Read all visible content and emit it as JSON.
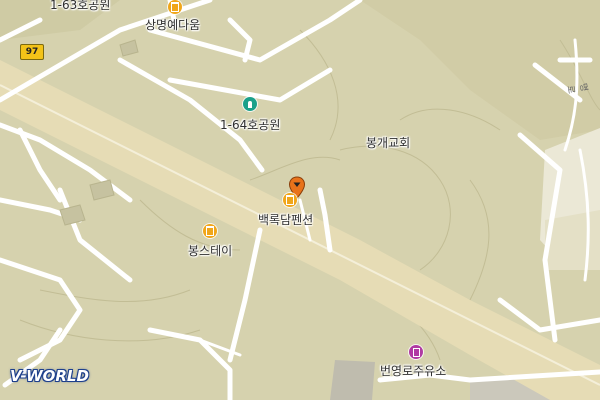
{
  "map": {
    "route_shield": "97",
    "labels": {
      "park_1_63": "1-63호공원",
      "sangmyeong": "상명예다움",
      "park_1_64": "1-64호공원",
      "bonggae_church": "봉개교회",
      "baekrokdam": "백록담펜션",
      "bongstay": "봉스테이",
      "gas_station": "번영로주유소",
      "small_road": "명로"
    },
    "colors": {
      "land": "#d6d2ae",
      "road": "#ffffff",
      "highway": "#e6dbb3",
      "lodging": "#f0a61a",
      "park": "#1aa08a",
      "gas": "#b03aa3",
      "marker": "#e8731b"
    },
    "logo": "V-WORLD"
  }
}
